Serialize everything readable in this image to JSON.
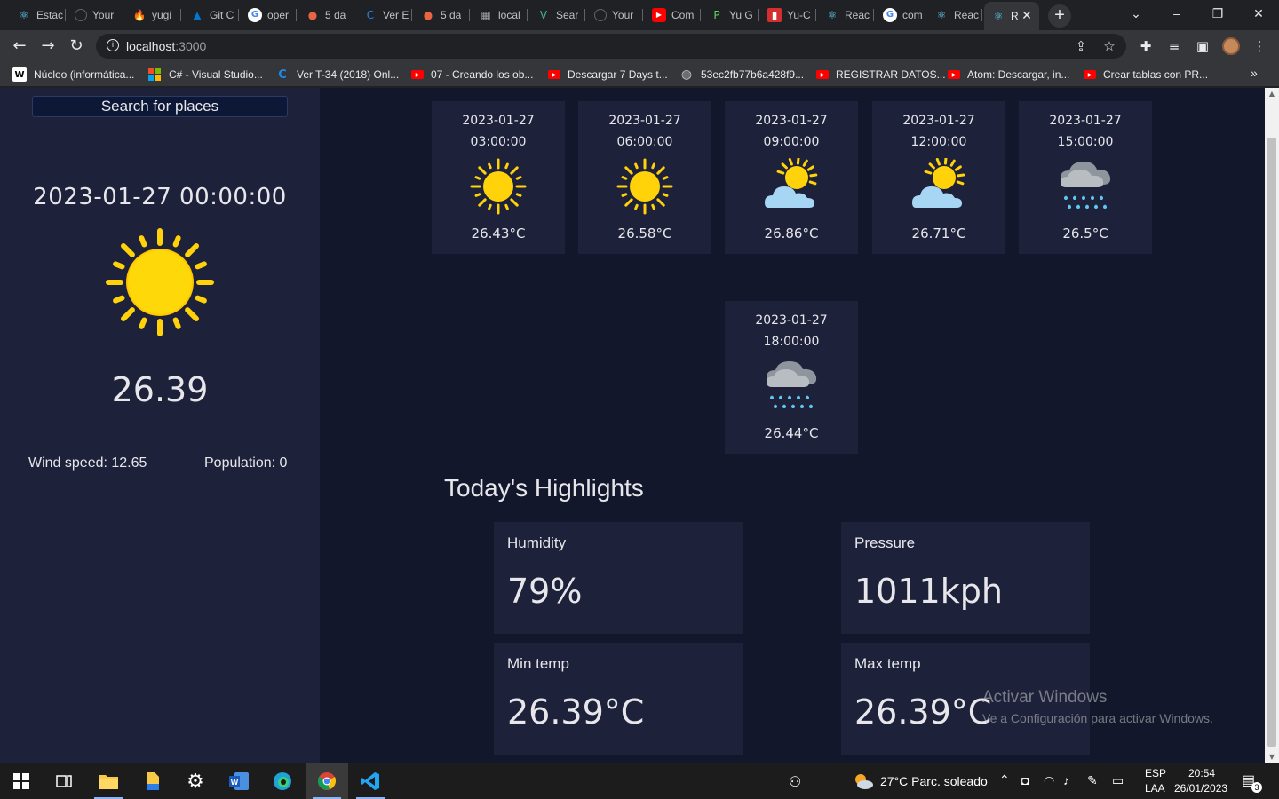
{
  "browser": {
    "tabs": [
      {
        "label": "Estac",
        "icon": "react-icon"
      },
      {
        "label": "Your",
        "icon": "github-icon"
      },
      {
        "label": "yugi",
        "icon": "firebase-icon"
      },
      {
        "label": "Git C",
        "icon": "azure-icon"
      },
      {
        "label": "oper",
        "icon": "google-icon"
      },
      {
        "label": "5 da",
        "icon": "weather-icon"
      },
      {
        "label": "Ver E",
        "icon": "crunchyroll-icon"
      },
      {
        "label": "5 da",
        "icon": "weather-icon"
      },
      {
        "label": "local",
        "icon": "grid-icon"
      },
      {
        "label": "Sear",
        "icon": "vue-icon"
      },
      {
        "label": "Your",
        "icon": "github-icon"
      },
      {
        "label": "Com",
        "icon": "youtube-icon"
      },
      {
        "label": "Yu G",
        "icon": "p-icon"
      },
      {
        "label": "Yu-C",
        "icon": "card-icon"
      },
      {
        "label": "Reac",
        "icon": "react-icon"
      },
      {
        "label": "com",
        "icon": "google-icon"
      },
      {
        "label": "Reac",
        "icon": "react-icon"
      },
      {
        "label": "R",
        "icon": "react-icon"
      }
    ],
    "url_host": "localhost",
    "url_port": ":3000",
    "bookmarks": [
      {
        "label": "Núcleo (informática...",
        "icon": "wikipedia-icon"
      },
      {
        "label": "C# - Visual Studio...",
        "icon": "microsoft-icon"
      },
      {
        "label": "Ver T-34 (2018) Onl...",
        "icon": "crunchyroll-icon"
      },
      {
        "label": "07 - Creando los ob...",
        "icon": "youtube-icon"
      },
      {
        "label": "Descargar 7 Days t...",
        "icon": "youtube-icon"
      },
      {
        "label": "53ec2fb77b6a428f9...",
        "icon": "globe-icon"
      },
      {
        "label": "REGISTRAR DATOS...",
        "icon": "youtube-icon"
      },
      {
        "label": "Atom: Descargar, in...",
        "icon": "youtube-icon"
      },
      {
        "label": "Crear tablas con PR...",
        "icon": "youtube-icon"
      }
    ],
    "bookmarks_more": "»"
  },
  "sidebar": {
    "search_label": "Search for places",
    "current_datetime": "2023-01-27 00:00:00",
    "current_icon": "sun-icon",
    "current_temp": "26.39",
    "wind": "Wind speed: 12.65",
    "population": "Population: 0"
  },
  "forecast": [
    {
      "date": "2023-01-27",
      "time": "03:00:00",
      "icon": "sun",
      "temp": "26.43°C"
    },
    {
      "date": "2023-01-27",
      "time": "06:00:00",
      "icon": "sun",
      "temp": "26.58°C"
    },
    {
      "date": "2023-01-27",
      "time": "09:00:00",
      "icon": "partly-cloudy",
      "temp": "26.86°C"
    },
    {
      "date": "2023-01-27",
      "time": "12:00:00",
      "icon": "partly-cloudy",
      "temp": "26.71°C"
    },
    {
      "date": "2023-01-27",
      "time": "15:00:00",
      "icon": "rain",
      "temp": "26.5°C"
    },
    {
      "date": "2023-01-27",
      "time": "18:00:00",
      "icon": "rain",
      "temp": "26.44°C"
    }
  ],
  "highlights": {
    "title": "Today's Highlights",
    "humidity": {
      "label": "Humidity",
      "value": "79%"
    },
    "pressure": {
      "label": "Pressure",
      "value": "1011kph"
    },
    "min_temp": {
      "label": "Min temp",
      "value": "26.39°C"
    },
    "max_temp": {
      "label": "Max temp",
      "value": "26.39°C"
    }
  },
  "watermark": {
    "line1": "Activar Windows",
    "line2": "Ve a Configuración para activar Windows."
  },
  "taskbar": {
    "weather": "27°C  Parc. soleado",
    "lang_1": "ESP",
    "lang_2": "LAA",
    "time": "20:54",
    "date": "26/01/2023",
    "notifications": "3"
  },
  "colors": {
    "sidebar_bg": "#1e213a",
    "main_bg": "#12172b",
    "card_bg": "#1e213a",
    "sun": "#ffd20a",
    "text": "#e7e7eb"
  }
}
